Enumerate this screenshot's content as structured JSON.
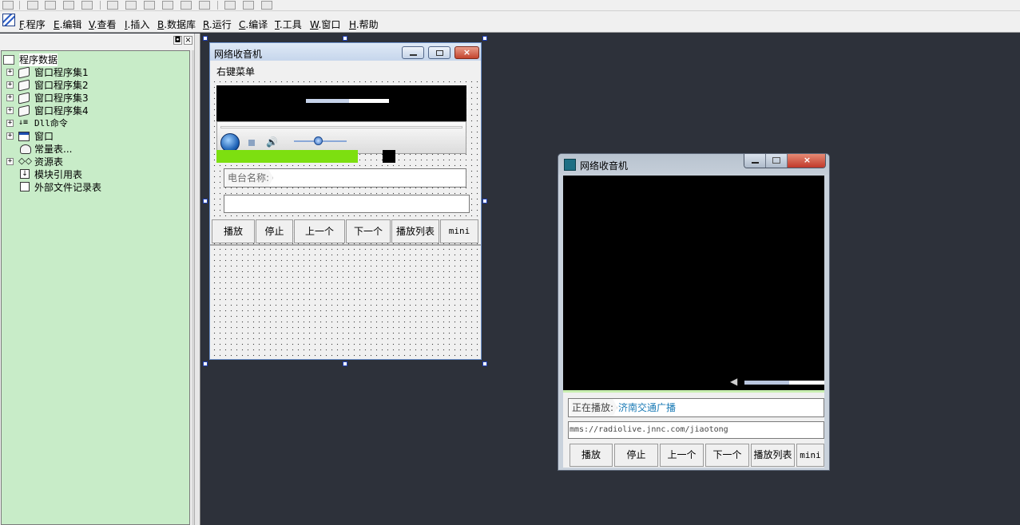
{
  "menubar": {
    "items": [
      {
        "key": "F",
        "label": ".程序"
      },
      {
        "key": "E",
        "label": ".编辑"
      },
      {
        "key": "V",
        "label": ".查看"
      },
      {
        "key": "I",
        "label": ".插入"
      },
      {
        "key": "B",
        "label": ".数据库"
      },
      {
        "key": "R",
        "label": ".运行"
      },
      {
        "key": "C",
        "label": ".编译"
      },
      {
        "key": "T",
        "label": ".工具"
      },
      {
        "key": "W",
        "label": ".窗口"
      },
      {
        "key": "H",
        "label": ".帮助"
      }
    ]
  },
  "left_panel": {
    "pin_glyph": "◘",
    "close_glyph": "×",
    "tree": {
      "root": "程序数据",
      "items": [
        {
          "label": "窗口程序集1",
          "icon": "module-icon",
          "expandable": true
        },
        {
          "label": "窗口程序集2",
          "icon": "module-icon",
          "expandable": true
        },
        {
          "label": "窗口程序集3",
          "icon": "module-icon",
          "expandable": true
        },
        {
          "label": "窗口程序集4",
          "icon": "module-icon",
          "expandable": true
        },
        {
          "label": "Dll命令",
          "icon": "dll-icon",
          "expandable": true
        },
        {
          "label": "窗口",
          "icon": "window-icon",
          "expandable": true
        },
        {
          "label": "常量表...",
          "icon": "constant-icon",
          "expandable": false
        },
        {
          "label": "资源表",
          "icon": "resource-icon",
          "expandable": true
        },
        {
          "label": "模块引用表",
          "icon": "module-ref-icon",
          "expandable": false
        },
        {
          "label": "外部文件记录表",
          "icon": "file-record-icon",
          "expandable": false
        }
      ]
    }
  },
  "designer": {
    "title": "网络收音机",
    "context_menu_label": "右键菜单",
    "station_label": "电台名称:",
    "station_value": "",
    "url_value": "",
    "buttons": [
      "播放",
      "停止",
      "上一个",
      "下一个",
      "播放列表",
      "mini"
    ],
    "progress": 0.56,
    "volume": 0.45
  },
  "runtime": {
    "title": "网络收音机",
    "now_playing_label": "正在播放:",
    "now_playing_value": "济南交通广播",
    "url": "mms://radiolive.jnnc.com/jiaotong",
    "buttons": [
      "播放",
      "停止",
      "上一个",
      "下一个",
      "播放列表",
      "mini"
    ],
    "volume": 0.56
  },
  "colors": {
    "workspace": "#2d313a",
    "tree_bg": "#c8ecc8",
    "progress_green": "#7ddf10",
    "station_link": "#1b7bb6"
  }
}
